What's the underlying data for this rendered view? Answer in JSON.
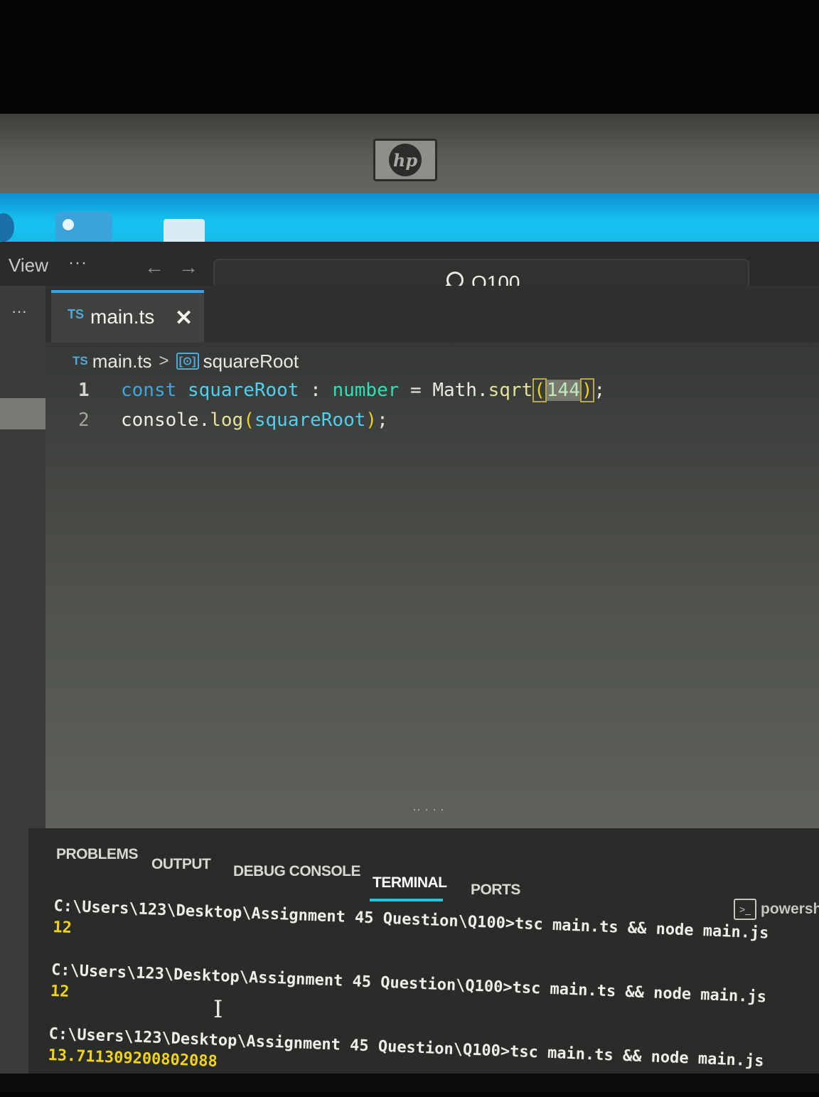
{
  "device": {
    "brand_logo": "hp"
  },
  "menubar": {
    "view": "View",
    "more": "···"
  },
  "command_center": {
    "search_label": "Q100"
  },
  "sidebar": {
    "more": "···"
  },
  "tabs": [
    {
      "icon": "TS",
      "label": "main.ts",
      "close": "✕"
    }
  ],
  "breadcrumb": {
    "file_icon": "TS",
    "file": "main.ts",
    "separator": ">",
    "symbol_icon": "[⊙]",
    "symbol": "squareRoot"
  },
  "code": {
    "line1": {
      "number": "1",
      "kw": "const",
      "var": "squareRoot",
      "colon": " : ",
      "type": "number",
      "eq": " = ",
      "obj": "Math.",
      "fn": "sqrt",
      "open": "(",
      "arg": "144",
      "close": ")",
      "end": ";"
    },
    "line2": {
      "number": "2",
      "obj": "console.",
      "fn": "log",
      "open": "(",
      "arg": "squareRoot",
      "close": ")",
      "end": ";"
    }
  },
  "panel": {
    "tabs": [
      "PROBLEMS",
      "OUTPUT",
      "DEBUG CONSOLE",
      "TERMINAL",
      "PORTS"
    ],
    "active_tab": "TERMINAL",
    "shell": "powersh"
  },
  "terminal": {
    "lines": [
      {
        "prompt": "C:\\Users\\123\\Desktop\\Assignment 45 Question\\Q100>tsc main.ts && node main.js",
        "output": "12"
      },
      {
        "prompt": "C:\\Users\\123\\Desktop\\Assignment 45 Question\\Q100>tsc main.ts && node main.js",
        "output": "12"
      },
      {
        "prompt": "C:\\Users\\123\\Desktop\\Assignment 45 Question\\Q100>tsc main.ts && node main.js",
        "output": "13.711309200802088"
      }
    ]
  },
  "colors": {
    "accent": "#3aa0e6",
    "terminal_output": "#f0d21c",
    "taskbar": "#16c3f0"
  }
}
